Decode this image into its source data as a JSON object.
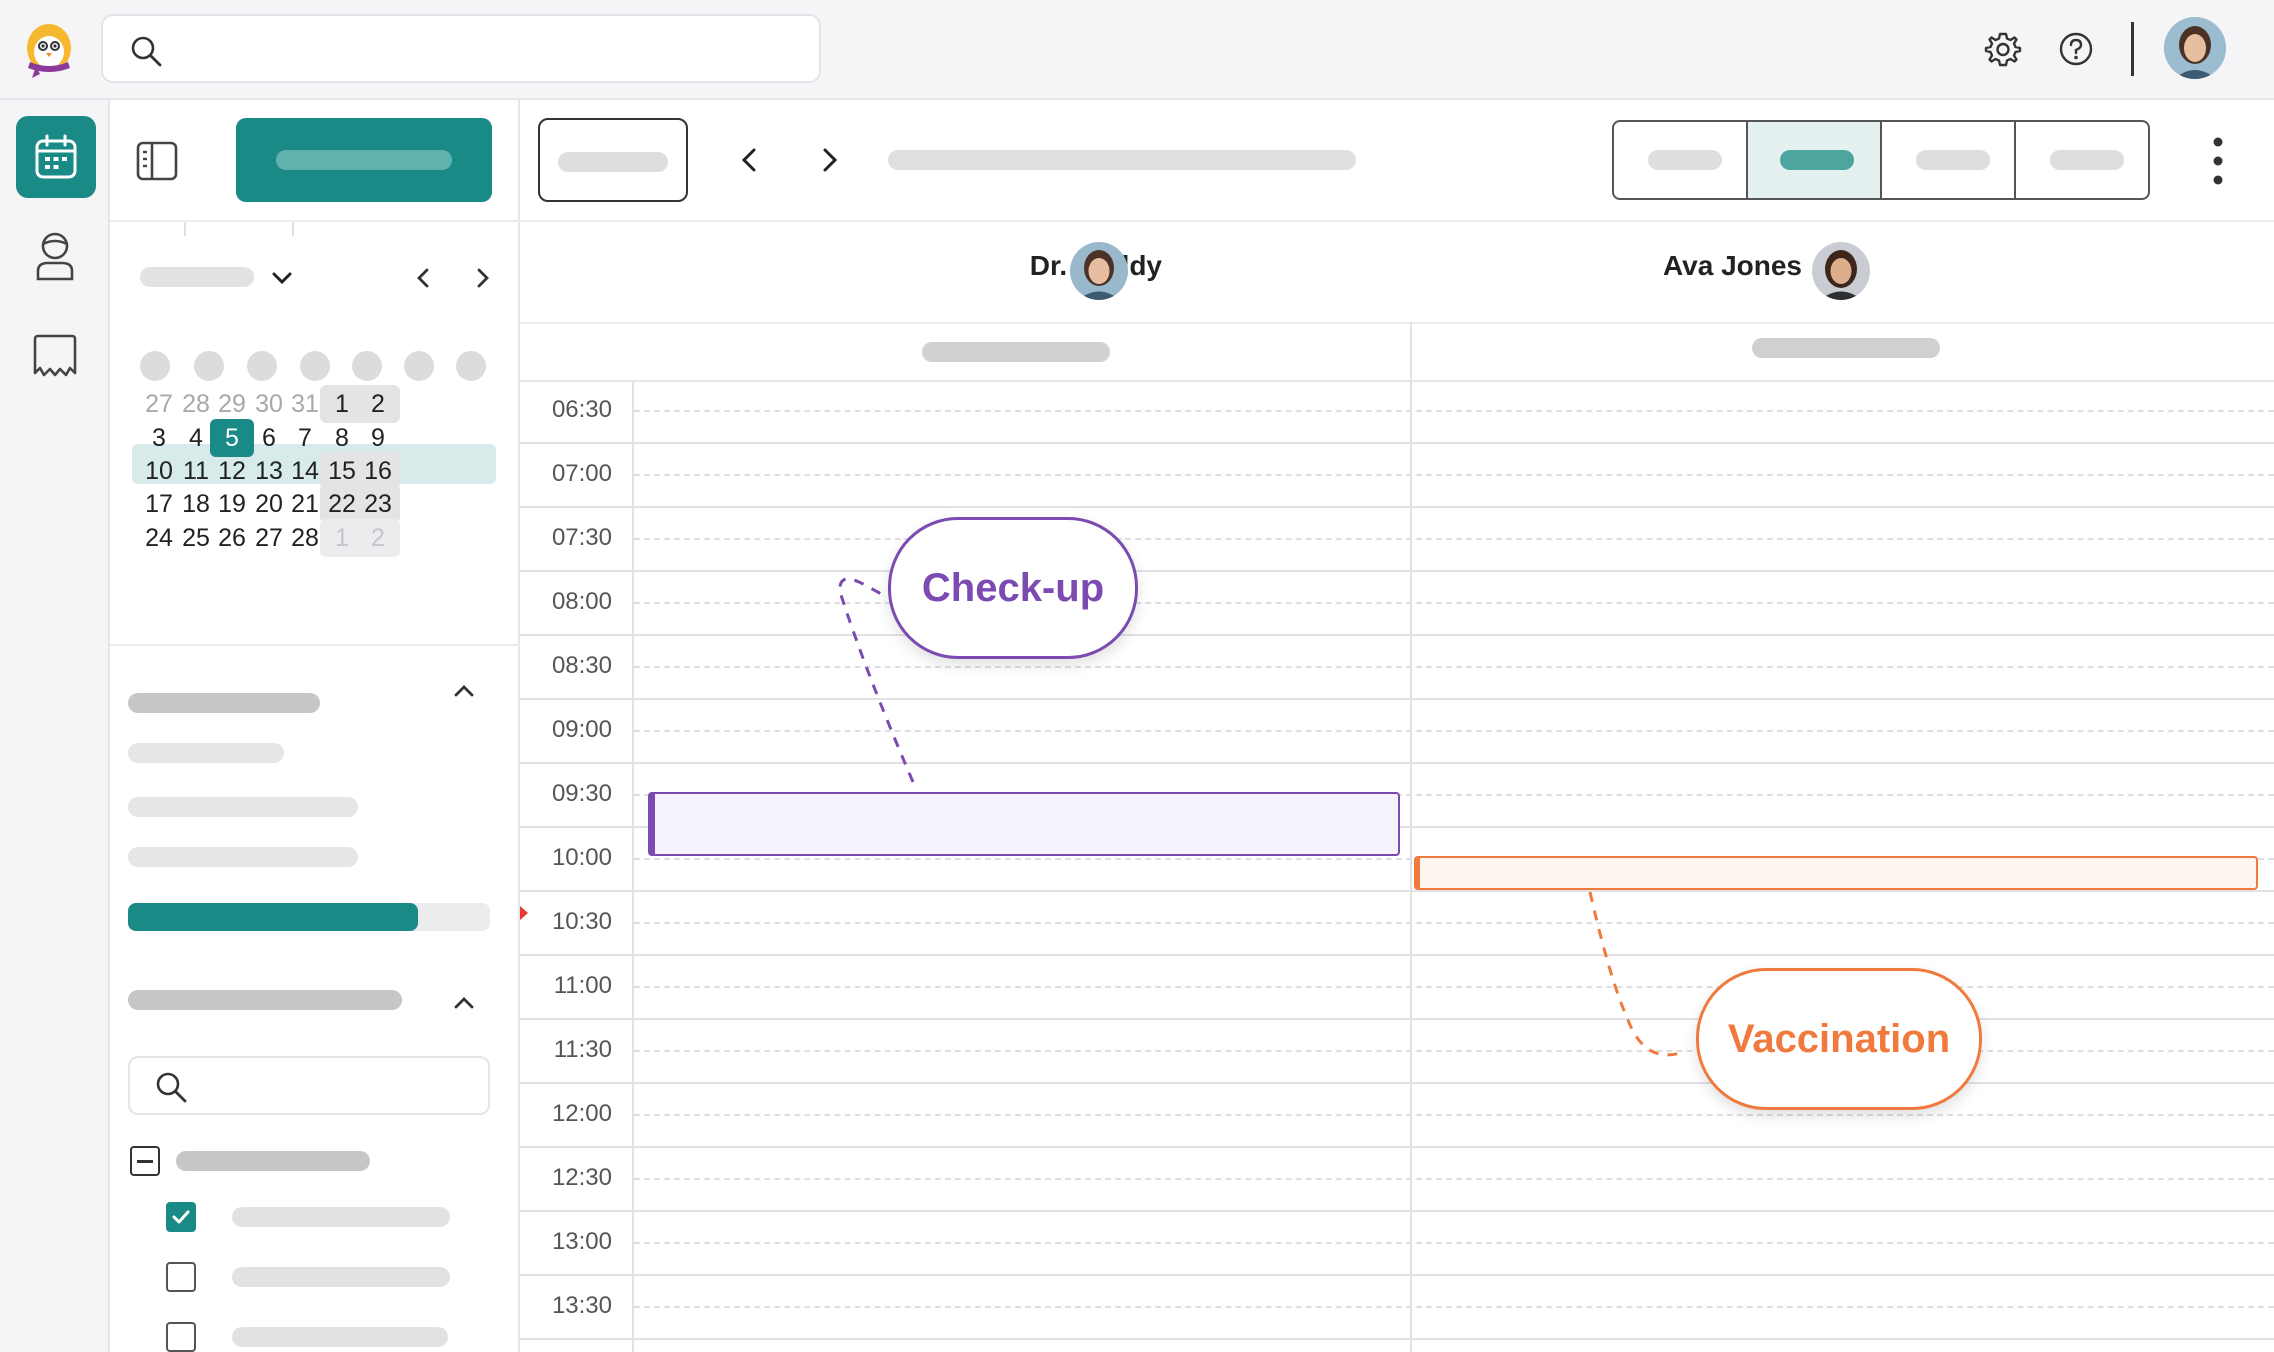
{
  "colors": {
    "accent": "#198a86",
    "checkup": "#7b4bb2",
    "vaccination": "#f07a3e",
    "now": "#e53b2c"
  },
  "header": {
    "icons": [
      "search-icon",
      "gear-icon",
      "help-icon",
      "avatar"
    ]
  },
  "rail": {
    "items": [
      "calendar-icon",
      "patient-icon",
      "book-icon"
    ]
  },
  "mini_calendar": {
    "rows": [
      [
        "27",
        "28",
        "29",
        "30",
        "31",
        "1",
        "2"
      ],
      [
        "3",
        "4",
        "5",
        "6",
        "7",
        "8",
        "9"
      ],
      [
        "10",
        "11",
        "12",
        "13",
        "14",
        "15",
        "16"
      ],
      [
        "17",
        "18",
        "19",
        "20",
        "21",
        "22",
        "23"
      ],
      [
        "24",
        "25",
        "26",
        "27",
        "28",
        "1",
        "2"
      ]
    ],
    "selected": "5"
  },
  "columns": [
    {
      "name": "Dr. Cuddy"
    },
    {
      "name": "Ava Jones"
    }
  ],
  "times": [
    "06:30",
    "07:00",
    "07:30",
    "08:00",
    "08:30",
    "09:00",
    "09:30",
    "10:00",
    "10:30",
    "11:00",
    "11:30",
    "12:00",
    "12:30",
    "13:00",
    "13:30"
  ],
  "callouts": {
    "checkup": "Check-up",
    "vaccination": "Vaccination"
  }
}
